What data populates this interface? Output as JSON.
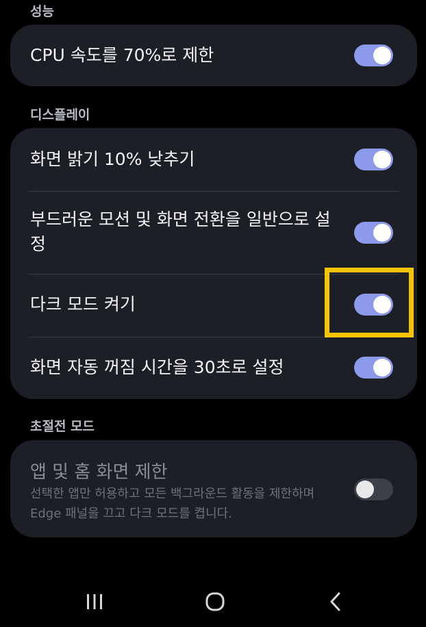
{
  "sections": {
    "performance": {
      "label": "성능",
      "items": [
        {
          "label": "CPU 속도를 70%로 제한",
          "enabled": true
        }
      ]
    },
    "display": {
      "label": "디스플레이",
      "items": [
        {
          "label": "화면 밝기 10% 낮추기",
          "enabled": true
        },
        {
          "label": "부드러운 모션 및 화면 전환을 일반으로 설정",
          "enabled": true
        },
        {
          "label": "다크 모드 켜기",
          "enabled": true
        },
        {
          "label": "화면 자동 꺼짐 시간을 30초로 설정",
          "enabled": true
        }
      ]
    },
    "ultra_saving": {
      "label": "초절전 모드",
      "title": "앱 및 홈 화면 제한",
      "description": "선택한 앱만 허용하고 모든 백그라운드 활동을 제한하며 Edge 패널을 끄고 다크 모드를 켭니다.",
      "enabled": false
    }
  },
  "colors": {
    "background": "#000000",
    "card": "#1d1f27",
    "toggle_on": "#8d99e9",
    "highlight": "#f5c400"
  },
  "navbar": {
    "recents_icon": "recents-icon",
    "home_icon": "home-icon",
    "back_icon": "back-icon"
  }
}
